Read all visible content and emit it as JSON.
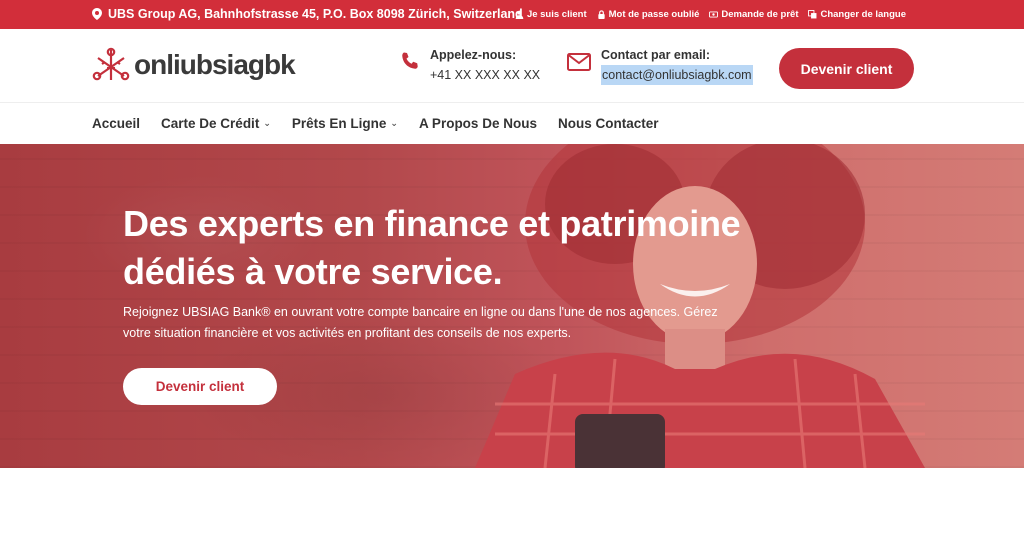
{
  "topbar": {
    "address": "UBS Group AG, Bahnhofstrasse 45, P.O. Box 8098 Zürich, Switzerland",
    "links": [
      {
        "label": "Je suis client",
        "icon": "user-icon"
      },
      {
        "label": "Mot de passe oublié",
        "icon": "lock-icon"
      },
      {
        "label": "Demande de prêt",
        "icon": "money-icon"
      },
      {
        "label": "Changer de langue",
        "icon": "language-icon"
      }
    ]
  },
  "header": {
    "logo_text": "onliubsiagbk",
    "phone": {
      "label": "Appelez-nous:",
      "value": "+41 XX XXX XX XX",
      "icon": "phone-icon"
    },
    "email": {
      "label": "Contact par email:",
      "value": "contact@onliubsiagbk.com",
      "icon": "envelope-icon"
    },
    "cta": "Devenir client"
  },
  "nav": {
    "items": [
      {
        "label": "Accueil",
        "dropdown": false
      },
      {
        "label": "Carte De Crédit",
        "dropdown": true
      },
      {
        "label": "Prêts En Ligne",
        "dropdown": true
      },
      {
        "label": "A Propos De Nous",
        "dropdown": false
      },
      {
        "label": "Nous Contacter",
        "dropdown": false
      }
    ]
  },
  "hero": {
    "title": "Des experts en finance et patrimoine dédiés à votre service.",
    "text": "Rejoignez UBSIAG Bank® en ouvrant votre compte bancaire en ligne ou dans l'une de nos agences. Gérez votre situation financière et vos activités en profitant des conseils de nos experts.",
    "cta": "Devenir client"
  },
  "colors": {
    "brand_red": "#d22e3a",
    "button_red": "#c4303c",
    "text_dark": "#333333",
    "selection_blue": "#b9d7f5"
  }
}
